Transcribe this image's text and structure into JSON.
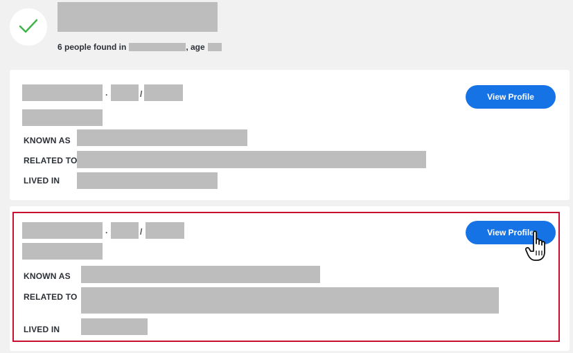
{
  "header": {
    "summary_prefix": "6 people found in",
    "summary_mid": ", age"
  },
  "results": [
    {
      "separator_dot": "·",
      "separator_slash": "/",
      "known_as_label": "KNOWN AS",
      "related_to_label": "RELATED TO",
      "lived_in_label": "LIVED IN",
      "button_label": "View Profile"
    },
    {
      "separator_dot": "·",
      "separator_slash": "/",
      "known_as_label": "KNOWN AS",
      "related_to_label": "RELATED TO",
      "lived_in_label": "LIVED IN",
      "button_label": "View Profile"
    }
  ],
  "colors": {
    "accent": "#1673e6",
    "highlight": "#c8102e",
    "check": "#3fb44a",
    "redaction": "#bdbdbd"
  },
  "icons": {
    "status": "checkmark-icon",
    "pointer": "hand-pointer-icon"
  }
}
